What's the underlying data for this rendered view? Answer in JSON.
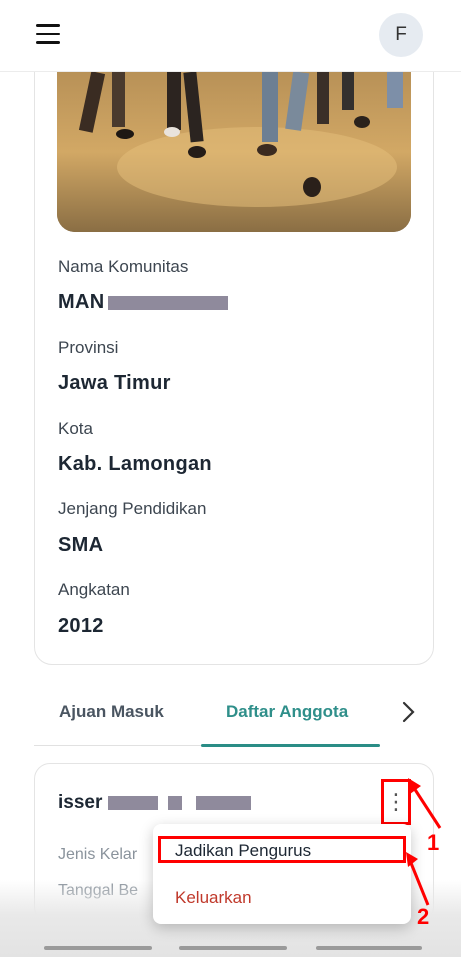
{
  "header": {
    "menu_icon": "hamburger-icon",
    "avatar_initial": "F"
  },
  "community": {
    "fields": [
      {
        "label": "Nama Komunitas",
        "value": "MAN"
      },
      {
        "label": "Provinsi",
        "value": "Jawa Timur"
      },
      {
        "label": "Kota",
        "value": "Kab. Lamongan"
      },
      {
        "label": "Jenjang Pendidikan",
        "value": "SMA"
      },
      {
        "label": "Angkatan",
        "value": "2012"
      }
    ]
  },
  "tabs": {
    "items": [
      {
        "label": "Ajuan Masuk",
        "active": false
      },
      {
        "label": "Daftar Anggota",
        "active": true
      }
    ],
    "next_icon": "chevron-right-icon"
  },
  "member": {
    "name_prefix": "isser",
    "field1_label": "Jenis Kelar",
    "field2_label": "Tanggal Be",
    "options_icon": "kebab-menu-icon"
  },
  "context_menu": {
    "items": [
      {
        "label": "Jadikan Pengurus",
        "color": "#1d2733"
      },
      {
        "label": "Keluarkan",
        "color": "#c0392b"
      }
    ]
  },
  "annotations": {
    "marker_1": "1",
    "marker_2": "2",
    "color": "#ff0000"
  },
  "colors": {
    "accent": "#2a8d86",
    "danger": "#c0392b"
  }
}
